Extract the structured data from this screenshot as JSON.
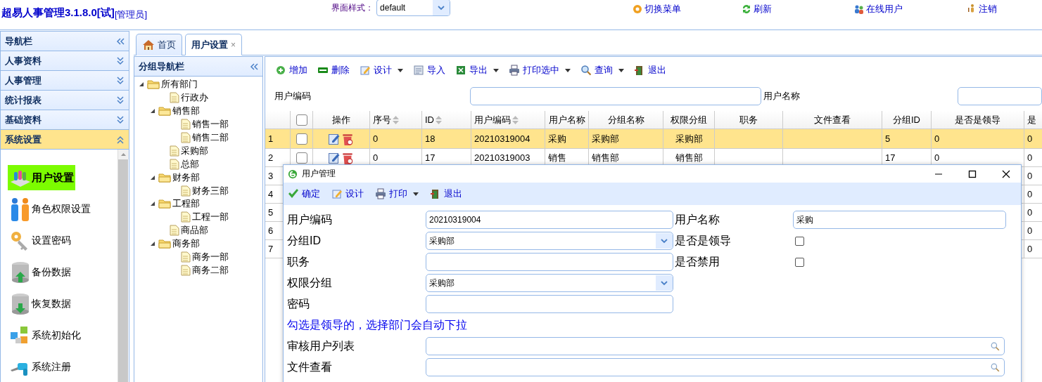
{
  "header": {
    "title": "超易人事管理3.1.8.0[试]",
    "role": "[管理员]",
    "theme_label": "界面样式：",
    "theme_value": "default",
    "links": [
      "切换菜单",
      "刷新",
      "在线用户",
      "注销"
    ]
  },
  "nav": {
    "title": "导航栏",
    "sections": [
      {
        "label": "人事资料",
        "expanded": false
      },
      {
        "label": "人事管理",
        "expanded": false
      },
      {
        "label": "统计报表",
        "expanded": false
      },
      {
        "label": "基础资料",
        "expanded": false
      },
      {
        "label": "系统设置",
        "expanded": true
      }
    ],
    "items": [
      {
        "label": "用户设置",
        "selected": true
      },
      {
        "label": "角色权限设置",
        "selected": false
      },
      {
        "label": "设置密码",
        "selected": false
      },
      {
        "label": "备份数据",
        "selected": false
      },
      {
        "label": "恢复数据",
        "selected": false
      },
      {
        "label": "系统初始化",
        "selected": false
      },
      {
        "label": "系统注册",
        "selected": false
      }
    ]
  },
  "tabs": [
    {
      "label": "首页",
      "selected": false,
      "closable": false
    },
    {
      "label": "用户设置",
      "selected": true,
      "closable": true,
      "close": "×"
    }
  ],
  "group_nav": {
    "title": "分组导航栏",
    "tree": [
      {
        "label": "所有部门",
        "expanded": true,
        "children": [
          {
            "label": "行政办"
          },
          {
            "label": "销售部",
            "expanded": true,
            "children": [
              {
                "label": "销售一部"
              },
              {
                "label": "销售二部"
              }
            ]
          },
          {
            "label": "采购部"
          },
          {
            "label": "总部"
          },
          {
            "label": "财务部",
            "expanded": true,
            "children": [
              {
                "label": "财务三部"
              }
            ]
          },
          {
            "label": "工程部",
            "expanded": true,
            "children": [
              {
                "label": "工程一部"
              }
            ]
          },
          {
            "label": "商品部"
          },
          {
            "label": "商务部",
            "expanded": true,
            "children": [
              {
                "label": "商务一部"
              },
              {
                "label": "商务二部"
              }
            ]
          }
        ]
      }
    ]
  },
  "toolbar": [
    {
      "label": "增加",
      "has_menu": false
    },
    {
      "label": "删除",
      "has_menu": false
    },
    {
      "label": "设计",
      "has_menu": true
    },
    {
      "label": "导入",
      "has_menu": false
    },
    {
      "label": "导出",
      "has_menu": true
    },
    {
      "label": "打印选中",
      "has_menu": true
    },
    {
      "label": "查询",
      "has_menu": true
    },
    {
      "label": "退出",
      "has_menu": false
    }
  ],
  "search": [
    {
      "label": "用户编码"
    },
    {
      "label": "用户名称"
    }
  ],
  "grid": {
    "header_checkbox": {
      "checked": false
    },
    "action_column": "操作",
    "columns": [
      {
        "label": "序号",
        "sortable": true
      },
      {
        "label": "ID",
        "sortable": true
      },
      {
        "label": "用户编码",
        "sortable": true
      },
      {
        "label": "用户名称",
        "sortable": false
      },
      {
        "label": "分组名称",
        "sortable": false
      },
      {
        "label": "权限分组",
        "sortable": false
      },
      {
        "label": "职务",
        "sortable": false
      },
      {
        "label": "文件查看",
        "sortable": false
      },
      {
        "label": "分组ID",
        "sortable": false
      },
      {
        "label": "是否是领导",
        "sortable": false
      },
      {
        "label": "是",
        "sortable": false
      }
    ],
    "rows": [
      {
        "number": "1",
        "selected": true,
        "checked": false,
        "cells": [
          "0",
          "18",
          "20210319004",
          "采购",
          "采购部",
          "采购部",
          null,
          null,
          "5",
          "0",
          "0"
        ]
      },
      {
        "number": "2",
        "selected": false,
        "checked": false,
        "cells": [
          "0",
          "17",
          "20210319003",
          "销售",
          "销售部",
          "销售部",
          null,
          null,
          "17",
          "0",
          "0"
        ]
      },
      {
        "number": "3",
        "selected": false,
        "cells": [
          null,
          null,
          null,
          null,
          null,
          null,
          null,
          null,
          null,
          null,
          "0"
        ]
      },
      {
        "number": "4",
        "selected": false,
        "cells": [
          null,
          null,
          null,
          null,
          null,
          null,
          null,
          null,
          null,
          null,
          "0"
        ]
      },
      {
        "number": "5",
        "selected": false,
        "cells": [
          null,
          null,
          null,
          null,
          null,
          null,
          null,
          null,
          null,
          null,
          "0"
        ]
      },
      {
        "number": "6",
        "selected": false,
        "cells": [
          null,
          null,
          null,
          null,
          null,
          null,
          null,
          null,
          null,
          null,
          "0"
        ]
      },
      {
        "number": "7",
        "selected": false,
        "cells": [
          null,
          null,
          null,
          null,
          null,
          null,
          null,
          null,
          null,
          null,
          "0"
        ]
      }
    ]
  },
  "dialog": {
    "title": "用户管理",
    "toolbar": [
      {
        "label": "确定",
        "has_menu": false
      },
      {
        "label": "设计",
        "has_menu": false
      },
      {
        "label": "打印",
        "has_menu": true
      },
      {
        "label": "退出",
        "has_menu": false
      }
    ],
    "rows": [
      {
        "left": {
          "label": "用户编码",
          "kind": "text",
          "value": "20210319004"
        },
        "right": {
          "label": "用户名称",
          "kind": "text",
          "value": "采购"
        }
      },
      {
        "left": {
          "label": "分组ID",
          "kind": "select",
          "value": "采购部"
        },
        "right": {
          "label": "是否是领导",
          "kind": "checkbox",
          "checked": false
        }
      },
      {
        "left": {
          "label": "职务",
          "kind": "text"
        },
        "right": {
          "label": "是否禁用",
          "kind": "checkbox",
          "checked": false
        }
      },
      {
        "left": {
          "label": "权限分组",
          "kind": "select",
          "value": "采购部"
        }
      },
      {
        "left": {
          "label": "密码",
          "kind": "text"
        }
      }
    ],
    "hint": "勾选是领导的，选择部门会自动下拉",
    "wide_fields": [
      {
        "label": "审核用户列表",
        "kind": "search"
      },
      {
        "label": "文件查看",
        "kind": "search"
      }
    ]
  }
}
